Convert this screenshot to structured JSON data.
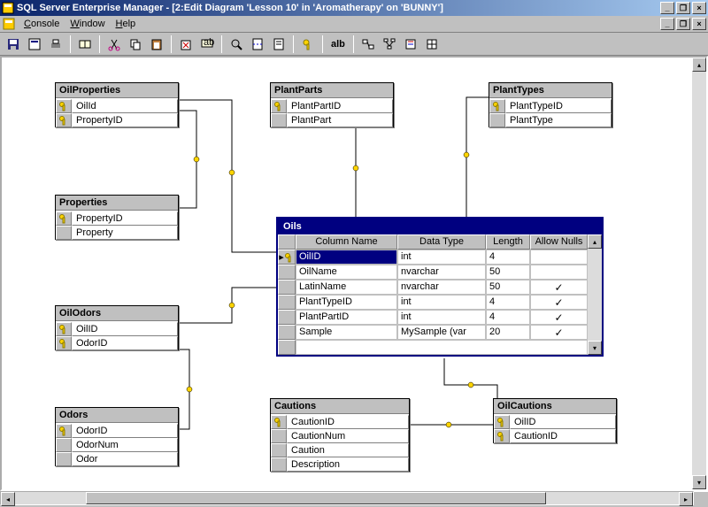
{
  "window": {
    "title": "SQL Server Enterprise Manager - [2:Edit Diagram 'Lesson 10' in 'Aromatherapy' on 'BUNNY']"
  },
  "menu": {
    "console": "Console",
    "window": "Window",
    "help": "Help"
  },
  "toolbar": {
    "abc_label": "alb"
  },
  "tables": {
    "oilProperties": {
      "title": "OilProperties",
      "cols": [
        "OilId",
        "PropertyID"
      ]
    },
    "properties": {
      "title": "Properties",
      "cols": [
        "PropertyID",
        "Property"
      ]
    },
    "oilOdors": {
      "title": "OilOdors",
      "cols": [
        "OilID",
        "OdorID"
      ]
    },
    "odors": {
      "title": "Odors",
      "cols": [
        "OdorID",
        "OdorNum",
        "Odor"
      ]
    },
    "plantParts": {
      "title": "PlantParts",
      "cols": [
        "PlantPartID",
        "PlantPart"
      ]
    },
    "plantTypes": {
      "title": "PlantTypes",
      "cols": [
        "PlantTypeID",
        "PlantType"
      ]
    },
    "cautions": {
      "title": "Cautions",
      "cols": [
        "CautionID",
        "CautionNum",
        "Caution",
        "Description"
      ]
    },
    "oilCautions": {
      "title": "OilCautions",
      "cols": [
        "OilID",
        "CautionID"
      ]
    }
  },
  "oils": {
    "title": "Oils",
    "headers": {
      "rowhdr": "",
      "colname": "Column Name",
      "datatype": "Data Type",
      "length": "Length",
      "allownulls": "Allow Nulls"
    },
    "rows": [
      {
        "sel": true,
        "key": true,
        "name": "OilID",
        "type": "int",
        "len": "4",
        "null": ""
      },
      {
        "sel": false,
        "key": false,
        "name": "OilName",
        "type": "nvarchar",
        "len": "50",
        "null": ""
      },
      {
        "sel": false,
        "key": false,
        "name": "LatinName",
        "type": "nvarchar",
        "len": "50",
        "null": "✓"
      },
      {
        "sel": false,
        "key": false,
        "name": "PlantTypeID",
        "type": "int",
        "len": "4",
        "null": "✓"
      },
      {
        "sel": false,
        "key": false,
        "name": "PlantPartID",
        "type": "int",
        "len": "4",
        "null": "✓"
      },
      {
        "sel": false,
        "key": false,
        "name": "Sample",
        "type": "MySample (var",
        "len": "20",
        "null": "✓"
      }
    ]
  }
}
